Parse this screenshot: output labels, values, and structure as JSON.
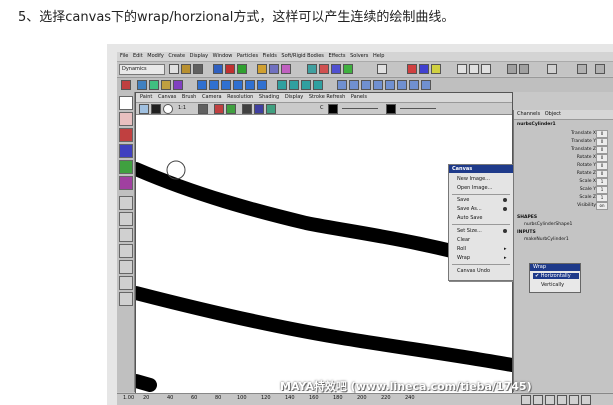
{
  "caption": "5、选择canvas下的wrap/horzional方式，这样可以产生连续的绘制曲线。",
  "main_menu": [
    "File",
    "Edit",
    "Modify",
    "Create",
    "Display",
    "Window",
    "Particles",
    "Fields",
    "Soft/Rigid Bodies",
    "Effects",
    "Solvers",
    "Help"
  ],
  "mode_dropdown": "Dynamics",
  "paint_menu": [
    "Paint",
    "Canvas",
    "Brush",
    "Camera",
    "Resolution",
    "Shading",
    "Display",
    "Stroke Refresh",
    "Panels"
  ],
  "paint_toolbar": {
    "ratio_label": "1:1",
    "channel_label": "C"
  },
  "canvas_menu": {
    "title": "Canvas",
    "items": [
      "New Image...",
      "Open Image...",
      "Save",
      "Save As...",
      "Auto Save",
      "Set Size...",
      "Clear",
      "Roll",
      "Wrap",
      "Canvas Undo"
    ]
  },
  "channel_box": {
    "tabs": [
      "Channels",
      "Object"
    ],
    "object_name": "nurbsCylinder1",
    "attributes": [
      {
        "name": "Translate X",
        "value": "0"
      },
      {
        "name": "Translate Y",
        "value": "0"
      },
      {
        "name": "Translate Z",
        "value": "0"
      },
      {
        "name": "Rotate X",
        "value": "0"
      },
      {
        "name": "Rotate Y",
        "value": "0"
      },
      {
        "name": "Rotate Z",
        "value": "0"
      },
      {
        "name": "Scale X",
        "value": "1"
      },
      {
        "name": "Scale Y",
        "value": "1"
      },
      {
        "name": "Scale Z",
        "value": "1"
      },
      {
        "name": "Visibility",
        "value": "on"
      }
    ],
    "shapes_label": "SHAPES",
    "shape_name": "nurbsCylinderShape1",
    "inputs_label": "INPUTS",
    "input_name": "makeNurbCylinder1"
  },
  "wrap_submenu": {
    "title": "Wrap",
    "items": [
      "Horizontally",
      "Vertically"
    ],
    "checked": "Horizontally"
  },
  "timeline_ticks": [
    "1.00",
    "20",
    "40",
    "60",
    "80",
    "100",
    "120",
    "140",
    "160",
    "180",
    "200",
    "220",
    "240"
  ],
  "watermark": "MAYA特效吧 (www.lineca.com/tieba/1745)",
  "colors": {
    "title_blue": "#1e3a8a",
    "stroke": "#000000",
    "canvas_bg": "#ffffff"
  }
}
